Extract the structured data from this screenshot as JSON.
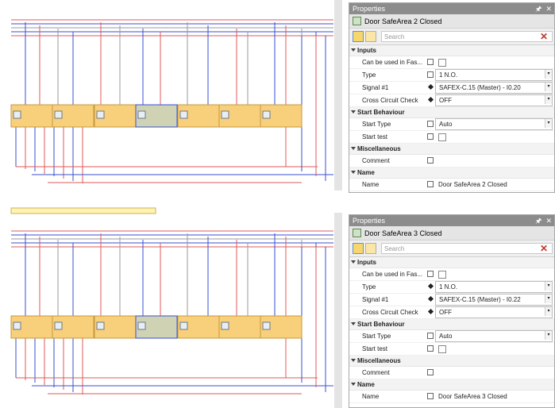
{
  "panels": [
    {
      "title": "Properties",
      "object_name": "Door SafeArea 2 Closed",
      "search_placeholder": "Search",
      "categories": [
        {
          "label": "Inputs",
          "rows": [
            {
              "name": "Can be used in Fas...",
              "marker": "box",
              "kind": "checkbox",
              "value": ""
            },
            {
              "name": "Type",
              "marker": "box",
              "kind": "dropdown",
              "value": "1 N.O."
            },
            {
              "name": "Signal #1",
              "marker": "diamond",
              "kind": "dropdown",
              "value": "SAFEX-C.15 (Master) - I0.20"
            },
            {
              "name": "Cross Circuit Check",
              "marker": "diamond",
              "kind": "dropdown",
              "value": "OFF"
            }
          ]
        },
        {
          "label": "Start Behaviour",
          "rows": [
            {
              "name": "Start Type",
              "marker": "box",
              "kind": "dropdown",
              "value": "Auto"
            },
            {
              "name": "Start test",
              "marker": "box",
              "kind": "checkbox",
              "value": ""
            }
          ]
        },
        {
          "label": "Miscellaneous",
          "rows": [
            {
              "name": "Comment",
              "marker": "box",
              "kind": "text",
              "value": ""
            }
          ]
        },
        {
          "label": "Name",
          "rows": [
            {
              "name": "Name",
              "marker": "box",
              "kind": "text",
              "value": "Door SafeArea 2 Closed"
            }
          ]
        }
      ]
    },
    {
      "title": "Properties",
      "object_name": "Door SafeArea 3 Closed",
      "search_placeholder": "Search",
      "categories": [
        {
          "label": "Inputs",
          "rows": [
            {
              "name": "Can be used in Fas...",
              "marker": "box",
              "kind": "checkbox",
              "value": ""
            },
            {
              "name": "Type",
              "marker": "diamond",
              "kind": "dropdown",
              "value": "1 N.O."
            },
            {
              "name": "Signal #1",
              "marker": "diamond",
              "kind": "dropdown",
              "value": "SAFEX-C.15 (Master) - I0.22"
            },
            {
              "name": "Cross Circuit Check",
              "marker": "diamond",
              "kind": "dropdown",
              "value": "OFF"
            }
          ]
        },
        {
          "label": "Start Behaviour",
          "rows": [
            {
              "name": "Start Type",
              "marker": "box",
              "kind": "dropdown",
              "value": "Auto"
            },
            {
              "name": "Start test",
              "marker": "box",
              "kind": "checkbox",
              "value": ""
            }
          ]
        },
        {
          "label": "Miscellaneous",
          "rows": [
            {
              "name": "Comment",
              "marker": "box",
              "kind": "text",
              "value": ""
            }
          ]
        },
        {
          "label": "Name",
          "rows": [
            {
              "name": "Name",
              "marker": "box",
              "kind": "text",
              "value": "Door SafeArea 3 Closed"
            }
          ]
        }
      ]
    }
  ],
  "colors": {
    "wire_red": "#e05a5a",
    "wire_blue": "#3a4fd0",
    "wire_gray": "#9a9a9a",
    "block_fill": "#f8cf7a",
    "block_selected": "#cfd3b4",
    "titlebar": "#8c8c8c"
  }
}
